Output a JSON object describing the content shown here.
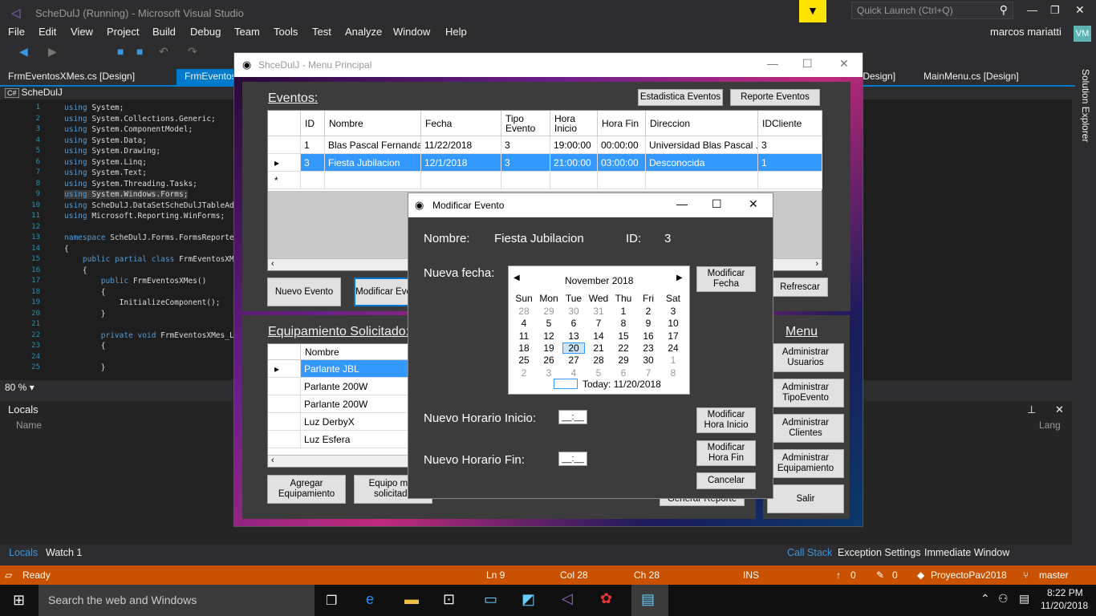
{
  "vs": {
    "title": "ScheDulJ (Running) - Microsoft Visual Studio",
    "quick_launch": "Quick Launch (Ctrl+Q)",
    "user": "marcos mariatti",
    "user_initials": "VM",
    "menu": [
      "File",
      "Edit",
      "View",
      "Project",
      "Build",
      "Debug",
      "Team",
      "Tools",
      "Test",
      "Analyze",
      "Window",
      "Help"
    ],
    "doc_tabs": [
      "FrmEventosXMes.cs [Design]",
      "FrmEventosX",
      "[Design]",
      "MainMenu.cs [Design]"
    ],
    "project_combo": "ScheDulJ",
    "zoom": "80 %",
    "solution_explorer": "Solution Explorer",
    "code_lines": [
      "using System;",
      "using System.Collections.Generic;",
      "using System.ComponentModel;",
      "using System.Data;",
      "using System.Drawing;",
      "using System.Linq;",
      "using System.Text;",
      "using System.Threading.Tasks;",
      "using System.Windows.Forms;",
      "using ScheDulJ.DataSetScheDulJTableAd",
      "using Microsoft.Reporting.WinForms;",
      "",
      "namespace ScheDulJ.Forms.FormsReporte",
      "{",
      "    public partial class FrmEventosXM",
      "    {",
      "        public FrmEventosXMes()",
      "        {",
      "            InitializeComponent();",
      "        }",
      "",
      "        private void FrmEventosXMes_L",
      "        {",
      "",
      "        }"
    ],
    "locals": {
      "title": "Locals",
      "col_name": "Name",
      "col_lang": "Lang"
    },
    "bottom_tabs": [
      "Locals",
      "Watch 1"
    ],
    "debug_tabs": [
      "Call Stack",
      "Exception Settings",
      "Immediate Window"
    ],
    "status": {
      "ready": "Ready",
      "ln": "Ln 9",
      "col": "Col 28",
      "ch": "Ch 28",
      "ins": "INS",
      "up": "0",
      "edits": "0",
      "project": "ProyectoPav2018",
      "branch": "master"
    },
    "taskbar": {
      "search": "Search the web and Windows",
      "time": "8:22 PM",
      "date": "11/20/2018"
    }
  },
  "app": {
    "title": "ShceDulJ - Menu Principal",
    "eventos_label": "Eventos:",
    "btn_estadistica": "Estadistica Eventos",
    "btn_reporte": "Reporte Eventos",
    "columns": [
      "ID",
      "Nombre",
      "Fecha",
      "Tipo Evento",
      "Hora Inicio",
      "Hora Fin",
      "Direccion",
      "IDCliente"
    ],
    "rows": [
      [
        "1",
        "Blas Pascal Fernanda",
        "11/22/2018",
        "3",
        "19:00:00",
        "00:00:00",
        "Universidad Blas Pascal ...",
        "3"
      ],
      [
        "3",
        "Fiesta Jubilacion",
        "12/1/2018",
        "3",
        "21:00:00",
        "03:00:00",
        "Desconocida",
        "1"
      ]
    ],
    "new_row_marker": "*",
    "btn_nuevo": "Nuevo Evento",
    "btn_modificar": "Modificar Evento",
    "btn_refrescar": "Refrescar",
    "equip_label": "Equipamiento Solicitado:",
    "equip_col": "Nombre",
    "equip_rows": [
      "Parlante JBL",
      "Parlante 200W",
      "Parlante 200W",
      "Luz DerbyX",
      "Luz Esfera"
    ],
    "btn_agregar": "Agregar Equipamiento",
    "btn_equipo_mas": "Equipo más solicitado",
    "btn_generar": "Generar Reporte",
    "menu_label": "Menu",
    "menu_buttons": [
      "Administrar Usuarios",
      "Administrar TipoEvento",
      "Administrar Clientes",
      "Administrar Equipamiento"
    ],
    "btn_salir": "Salir"
  },
  "dialog": {
    "title": "Modificar Evento",
    "nombre_label": "Nombre:",
    "nombre_value": "Fiesta Jubilacion",
    "id_label": "ID:",
    "id_value": "3",
    "fecha_label": "Nueva fecha:",
    "btn_mod_fecha": "Modificar Fecha",
    "inicio_label": "Nuevo Horario Inicio:",
    "fin_label": "Nuevo Horario Fin:",
    "time_placeholder": "__:__",
    "btn_mod_inicio": "Modificar Hora Inicio",
    "btn_mod_fin": "Modificar Hora Fin",
    "btn_cancelar": "Cancelar",
    "calendar": {
      "month": "November 2018",
      "days": [
        "Sun",
        "Mon",
        "Tue",
        "Wed",
        "Thu",
        "Fri",
        "Sat"
      ],
      "weeks": [
        [
          "28",
          "29",
          "30",
          "31",
          "1",
          "2",
          "3"
        ],
        [
          "4",
          "5",
          "6",
          "7",
          "8",
          "9",
          "10"
        ],
        [
          "11",
          "12",
          "13",
          "14",
          "15",
          "16",
          "17"
        ],
        [
          "18",
          "19",
          "20",
          "21",
          "22",
          "23",
          "24"
        ],
        [
          "25",
          "26",
          "27",
          "28",
          "29",
          "30",
          "1"
        ],
        [
          "2",
          "3",
          "4",
          "5",
          "6",
          "7",
          "8"
        ]
      ],
      "today": "Today: 11/20/2018"
    }
  }
}
